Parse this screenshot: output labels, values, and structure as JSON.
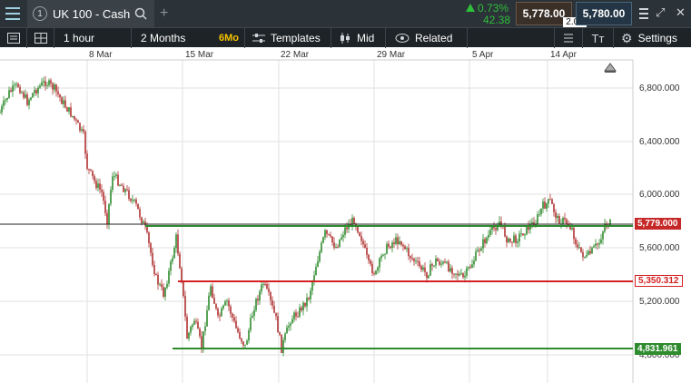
{
  "header": {
    "tab_number": "1",
    "instrument": "UK 100 - Cash",
    "change_pct": "0.73%",
    "change_pts": "42.38",
    "sell_price": "5,778.00",
    "buy_price": "5,780.00",
    "spread": "2.00"
  },
  "toolbar": {
    "interval": "1 hour",
    "range": "2 Months",
    "range_badge": "6Mo",
    "templates": "Templates",
    "price_type": "Mid",
    "related": "Related",
    "settings": "Settings"
  },
  "chart": {
    "dates": [
      "8 Mar",
      "15 Mar",
      "22 Mar",
      "29 Mar",
      "5 Apr",
      "14 Apr"
    ],
    "y_ticks": [
      "6,800.000",
      "6,400.000",
      "6,000.000",
      "5,600.000",
      "5,200.000",
      "4,800.000"
    ],
    "current_price_tag": "5,779.000",
    "red_level_tag": "5,350.312",
    "green_level_tag": "4,831.961",
    "colors": {
      "up": "#2e8b2e",
      "down": "#b03030",
      "red_level": "#d42020",
      "green_level": "#2e8b2e",
      "current_tag": "#c62828",
      "green_tag": "#2e8b2e"
    }
  }
}
